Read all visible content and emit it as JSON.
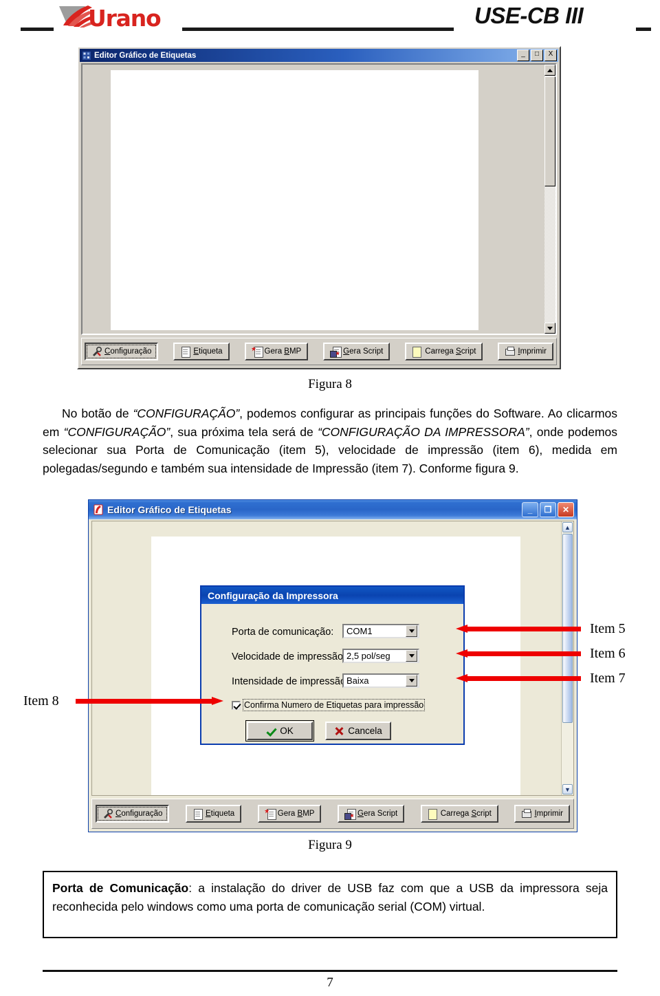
{
  "header": {
    "brand": "Urano",
    "product": "USE-CB III"
  },
  "figure8": {
    "window": {
      "title": "Editor Gráfico de Etiquetas",
      "minimize": "_",
      "maximize": "□",
      "close": "X"
    },
    "toolbar": [
      {
        "label_pre": "",
        "label_u": "C",
        "label_post": "onfiguração",
        "icon": "wrench-icon",
        "selected": true
      },
      {
        "label_pre": "",
        "label_u": "E",
        "label_post": "tiqueta",
        "icon": "document-icon",
        "selected": false
      },
      {
        "label_pre": "Gera ",
        "label_u": "B",
        "label_post": "MP",
        "icon": "bmp-icon",
        "selected": false
      },
      {
        "label_pre": "",
        "label_u": "G",
        "label_post": "era Script",
        "icon": "save-script-icon",
        "selected": false
      },
      {
        "label_pre": "Carrega ",
        "label_u": "S",
        "label_post": "cript",
        "icon": "load-script-icon",
        "selected": false
      },
      {
        "label_pre": "",
        "label_u": "I",
        "label_post": "mprimir",
        "icon": "printer-icon",
        "selected": false
      }
    ],
    "caption": "Figura 8"
  },
  "body_text": {
    "p1_a": "No botão de ",
    "p1_q1": "“CONFIGURAÇÃO”",
    "p1_b": ", podemos configurar as principais funções do Software. Ao clicarmos em ",
    "p1_q2": "“CONFIGURAÇÃO”",
    "p1_c": ", sua próxima tela será de ",
    "p1_q3": "“CONFIGURAÇÃO DA IMPRESSORA”",
    "p1_d": ", onde podemos selecionar sua Porta de Comunicação (item 5), velocidade de impressão (item 6), medida em polegadas/segundo e também sua intensidade de Impressão (item 7). Conforme figura 9."
  },
  "figure9": {
    "window": {
      "title": "Editor Gráfico de Etiquetas",
      "minimize": "_",
      "maximize": "❐",
      "close": "✕"
    },
    "dialog": {
      "title": "Configuração da Impressora",
      "fields": [
        {
          "label": "Porta de comunicação:",
          "value": "COM1"
        },
        {
          "label": "Velocidade de impressão:",
          "value": "2,5 pol/seg"
        },
        {
          "label": "Intensidade de impressão:",
          "value": "Baixa"
        }
      ],
      "checkbox": {
        "label": "Confirma Numero de Etiquetas para impressão",
        "checked": true
      },
      "buttons": [
        {
          "label": "OK",
          "icon": "check-icon"
        },
        {
          "label": "Cancela",
          "icon": "x-icon"
        }
      ]
    },
    "toolbar": [
      {
        "label_pre": "",
        "label_u": "C",
        "label_post": "onfiguração",
        "icon": "wrench-icon",
        "selected": true
      },
      {
        "label_pre": "",
        "label_u": "E",
        "label_post": "tiqueta",
        "icon": "document-icon",
        "selected": false
      },
      {
        "label_pre": "Gera ",
        "label_u": "B",
        "label_post": "MP",
        "icon": "bmp-icon",
        "selected": false
      },
      {
        "label_pre": "",
        "label_u": "G",
        "label_post": "era Script",
        "icon": "save-script-icon",
        "selected": false
      },
      {
        "label_pre": "Carrega ",
        "label_u": "S",
        "label_post": "cript",
        "icon": "load-script-icon",
        "selected": false
      },
      {
        "label_pre": "",
        "label_u": "I",
        "label_post": "mprimir",
        "icon": "printer-icon",
        "selected": false
      }
    ],
    "annotations": [
      {
        "label": "Item 5",
        "points": "left"
      },
      {
        "label": "Item 6",
        "points": "left"
      },
      {
        "label": "Item 7",
        "points": "left"
      },
      {
        "label": "Item 8",
        "points": "right"
      }
    ],
    "caption": "Figura 9"
  },
  "note": {
    "bold": "Porta de Comunicação",
    "rest": ": a instalação do driver de USB faz com que a USB da impressora seja reconhecida pelo windows como uma porta de comunicação serial (COM) virtual."
  },
  "page_number": "7",
  "colors": {
    "brand_red": "#d8241f",
    "arrow_red": "#ee0000",
    "titlebar_blue": "#0a246a",
    "xp_blue": "#2f6fd0",
    "dialog_face": "#ece9d8",
    "classic_face": "#d4d0c8"
  }
}
